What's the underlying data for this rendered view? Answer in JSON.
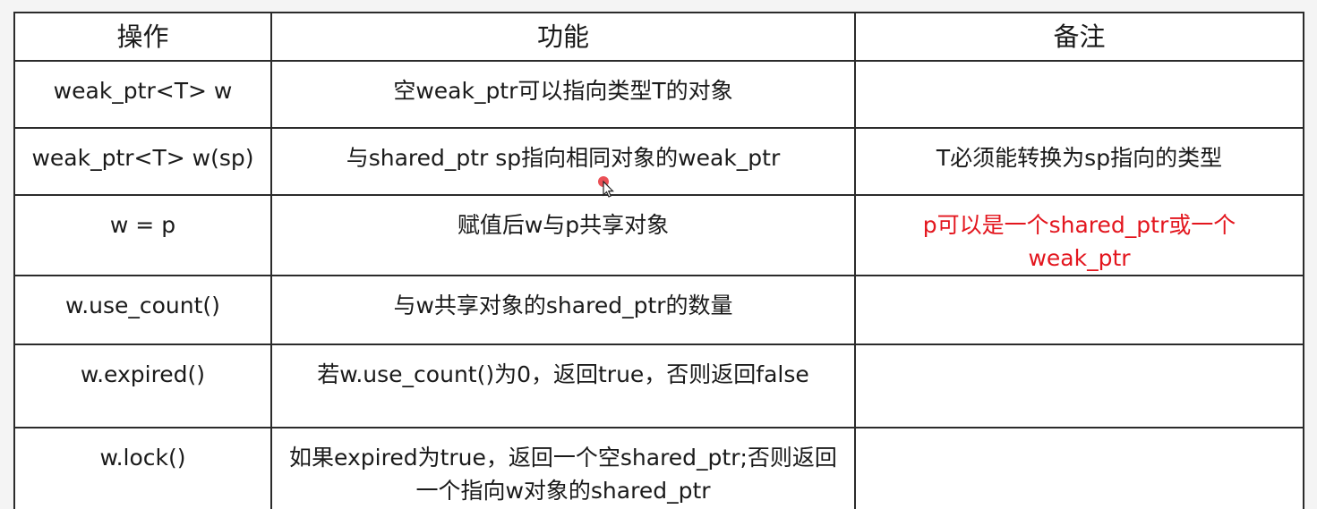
{
  "table": {
    "headers": [
      "操作",
      "功能",
      "备注"
    ],
    "rows": [
      {
        "op": "weak_ptr<T> w",
        "func": "空weak_ptr可以指向类型T的对象",
        "note": ""
      },
      {
        "op": "weak_ptr<T> w(sp)",
        "func": "与shared_ptr sp指向相同对象的weak_ptr",
        "note": "T必须能转换为sp指向的类型"
      },
      {
        "op": "w = p",
        "func": "赋值后w与p共享对象",
        "note": "p可以是一个shared_ptr或一个weak_ptr"
      },
      {
        "op": "w.use_count()",
        "func": "与w共享对象的shared_ptr的数量",
        "note": ""
      },
      {
        "op": "w.expired()",
        "func": "若w.use_count()为0，返回true，否则返回false",
        "note": ""
      },
      {
        "op": "w.lock()",
        "func": "如果expired为true，返回一个空shared_ptr;否则返回一个指向w对象的shared_ptr",
        "note": ""
      }
    ]
  },
  "colors": {
    "highlight_note": "#e3161e",
    "grid": "#2b2b2b"
  },
  "icons": {
    "cursor": "mouse-pointer-icon"
  }
}
